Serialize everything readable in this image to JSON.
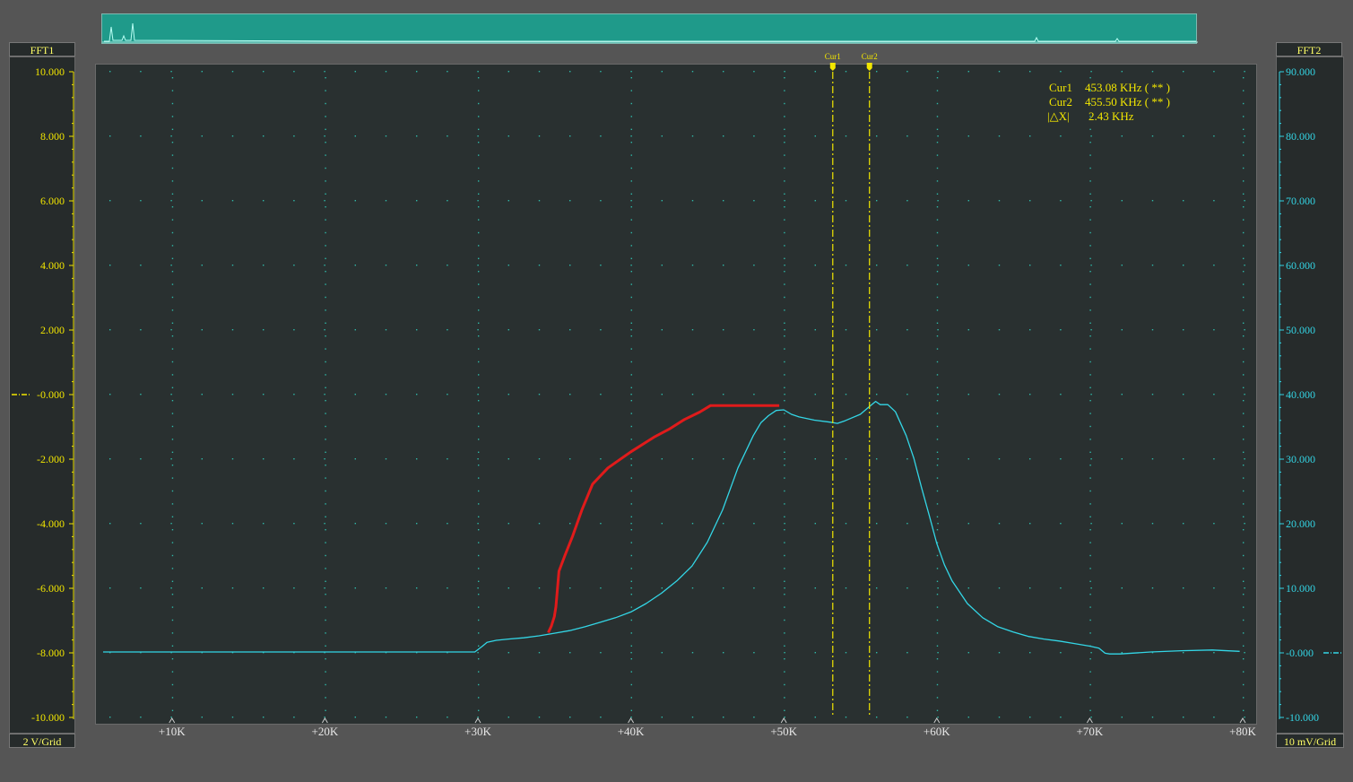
{
  "panels": {
    "left_title": "FFT1",
    "right_title": "FFT2",
    "left_scale": "2 V/Grid",
    "right_scale": "10 mV/Grid"
  },
  "cursor_readout": {
    "cur1_label": "Cur1",
    "cur1_value": "453.08 KHz ( ** )",
    "cur2_label": "Cur2",
    "cur2_value": "455.50 KHz ( ** )",
    "dx_label": "|△X|",
    "dx_value": "2.43 KHz"
  },
  "colors": {
    "background": "#555555",
    "plot_bg": "#293030",
    "cyan_trace": "#33d6e6",
    "red_trace": "#e01b1b",
    "cursor": "#f2e600",
    "left_axis": "#f2e600",
    "right_axis": "#33d6e6"
  },
  "chart_data": {
    "type": "line",
    "x_ticks": [
      "+10K",
      "+20K",
      "+30K",
      "+40K",
      "+50K",
      "+60K",
      "+70K",
      "+80K"
    ],
    "x_tick_values": [
      10,
      20,
      30,
      40,
      50,
      60,
      70,
      80
    ],
    "xlim": [
      5.5,
      80
    ],
    "left_axis": {
      "ticks": [
        "10.000",
        "8.000",
        "6.000",
        "4.000",
        "2.000",
        "-0.000",
        "-2.000",
        "-4.000",
        "-6.000",
        "-8.000",
        "-10.000"
      ],
      "tick_values": [
        10,
        8,
        6,
        4,
        2,
        0,
        -2,
        -4,
        -6,
        -8,
        -10
      ],
      "ylim": [
        -10,
        10
      ],
      "zero_marker": true
    },
    "right_axis": {
      "ticks": [
        "90.000",
        "80.000",
        "70.000",
        "60.000",
        "50.000",
        "40.000",
        "30.000",
        "20.000",
        "10.000",
        "-0.000",
        "-10.000"
      ],
      "tick_values": [
        90,
        80,
        70,
        60,
        50,
        40,
        30,
        20,
        10,
        0,
        -10
      ],
      "ylim": [
        -10,
        90
      ]
    },
    "cursors": [
      {
        "label": "Cur1",
        "x": 53.2
      },
      {
        "label": "Cur2",
        "x": 55.6
      }
    ],
    "series": [
      {
        "axis": "right",
        "color": "cyan",
        "x": [
          5.5,
          10,
          20,
          29.8,
          30.3,
          30.6,
          31.2,
          32,
          33,
          34,
          35,
          36,
          37,
          38,
          39,
          40,
          41,
          42,
          43,
          44,
          45,
          46,
          47,
          48,
          48.5,
          49,
          49.5,
          50,
          50.5,
          51,
          52,
          53,
          53.5,
          54,
          55,
          55.5,
          56,
          56.3,
          56.8,
          57.3,
          58,
          58.5,
          59,
          59.5,
          60,
          60.5,
          61,
          62,
          63,
          64,
          65,
          66,
          67,
          68,
          69,
          70,
          70.6,
          71,
          71.3,
          72,
          74,
          76,
          78,
          79.8
        ],
        "y": [
          0,
          0,
          0,
          0,
          0.9,
          1.5,
          1.8,
          2,
          2.2,
          2.5,
          2.9,
          3.3,
          3.9,
          4.6,
          5.3,
          6.2,
          7.5,
          9.1,
          11,
          13.3,
          17,
          22,
          28.5,
          33.5,
          35.5,
          36.6,
          37.4,
          37.5,
          36.8,
          36.4,
          35.9,
          35.6,
          35.4,
          35.8,
          36.8,
          37.8,
          38.8,
          38.3,
          38.3,
          37.2,
          33.5,
          30,
          25.5,
          21.2,
          16.8,
          13.5,
          11,
          7.5,
          5.3,
          3.9,
          3.1,
          2.4,
          2,
          1.7,
          1.3,
          0.9,
          0.6,
          -0.2,
          -0.3,
          -0.3,
          0,
          0.2,
          0.3,
          0.1
        ]
      },
      {
        "axis": "left",
        "color": "red",
        "x": [
          34.6,
          34.8,
          35,
          35.1,
          35.3,
          35.7,
          36.2,
          36.8,
          37.5,
          38.5,
          40,
          41.5,
          42.5,
          43.5,
          44.5,
          45.2,
          46,
          48,
          49.5,
          49.7
        ],
        "y": [
          -7.4,
          -7.2,
          -6.9,
          -6.6,
          -5.5,
          -5,
          -4.4,
          -3.6,
          -2.8,
          -2.3,
          -1.8,
          -1.35,
          -1.1,
          -0.8,
          -0.57,
          -0.37,
          -0.37,
          -0.37,
          -0.37,
          -0.37
        ]
      }
    ]
  }
}
